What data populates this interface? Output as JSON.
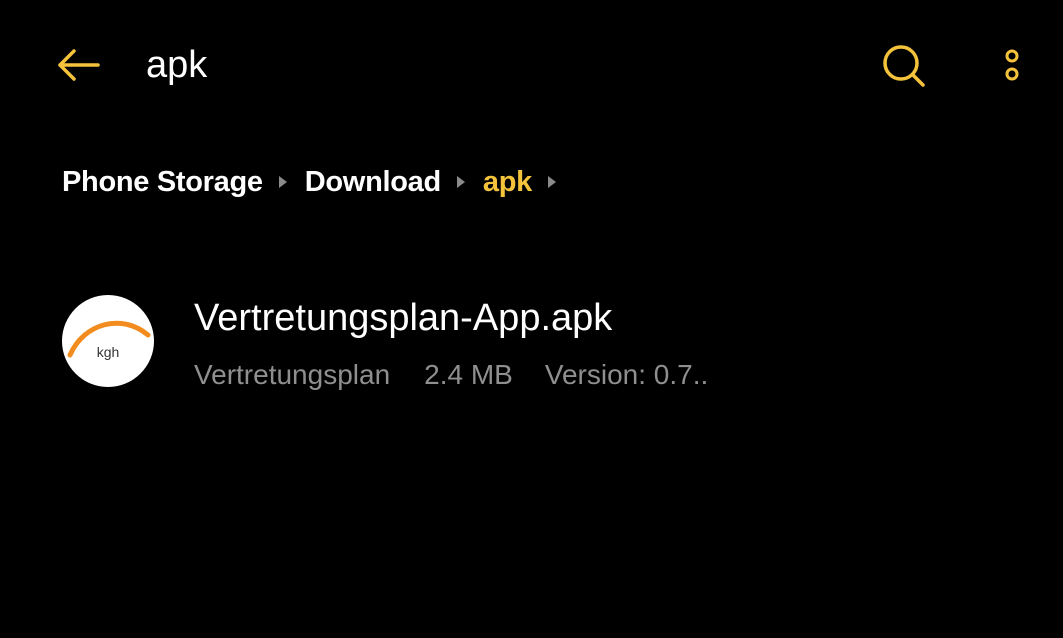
{
  "appbar": {
    "title": "apk",
    "back_icon": "arrow-left-icon",
    "search_icon": "search-icon",
    "more_icon": "more-vertical-icon"
  },
  "breadcrumb": {
    "items": [
      {
        "label": "Phone Storage"
      },
      {
        "label": "Download"
      },
      {
        "label": "apk"
      }
    ]
  },
  "files": [
    {
      "name": "Vertretungsplan-App.apk",
      "app_label": "Vertretungsplan",
      "size": "2.4 MB",
      "version": "Version: 0.7..",
      "icon_text": "kgh"
    }
  ],
  "colors": {
    "accent": "#f5c33b",
    "background": "#000000",
    "text_primary": "#ffffff",
    "text_secondary": "#8f8f8f",
    "icon_arc": "#f28c1e"
  }
}
